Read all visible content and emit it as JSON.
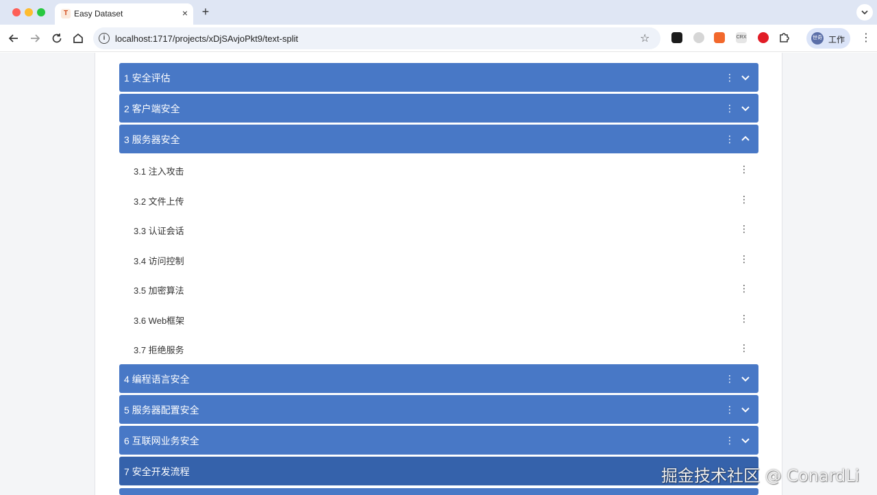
{
  "browser": {
    "tab_title": "Easy Dataset",
    "tab_favicon": "T",
    "new_tab_label": "+",
    "close_tab_label": "×",
    "url": "localhost:1717/projects/xDjSAvjoPkt9/text-split",
    "ext_crx_label": "CRX",
    "profile_avatar_text": "世奇",
    "profile_label": "工作"
  },
  "toc": {
    "chapters": [
      {
        "title": "1 安全评估",
        "expanded": false
      },
      {
        "title": "2 客户端安全",
        "expanded": false
      },
      {
        "title": "3 服务器安全",
        "expanded": true
      },
      {
        "title": "4 编程语言安全",
        "expanded": false
      },
      {
        "title": "5 服务器配置安全",
        "expanded": false
      },
      {
        "title": "6 互联网业务安全",
        "expanded": false
      },
      {
        "title": "7 安全开发流程",
        "expanded": false
      }
    ],
    "sections": [
      {
        "title": "3.1 注入攻击"
      },
      {
        "title": "3.2 文件上传"
      },
      {
        "title": "3.3 认证会话"
      },
      {
        "title": "3.4 访问控制"
      },
      {
        "title": "3.5 加密算法"
      },
      {
        "title": "3.6 Web框架"
      },
      {
        "title": "3.7 拒绝服务"
      }
    ]
  },
  "watermark": "掘金技术社区 @ ConardLi",
  "colors": {
    "chapter_bg": "#4878c6",
    "chapter_text": "#ffffff",
    "tab_bar": "#dfe6f4"
  },
  "icons": {
    "more": "more-vert-icon",
    "expand": "chevron-down-icon",
    "collapse": "chevron-up-icon"
  }
}
